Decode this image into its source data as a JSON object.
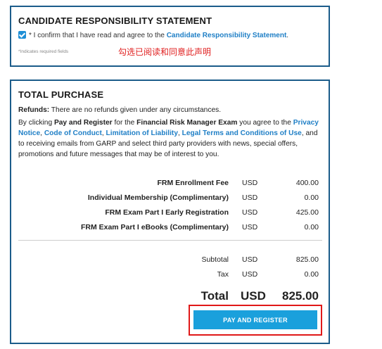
{
  "crs": {
    "title": "CANDIDATE RESPONSIBILITY STATEMENT",
    "confirm_text": "* I confirm that I have read and agree to the ",
    "confirm_link": "Candidate Responsibility Statement",
    "confirm_end": ".",
    "required_note": "*Indicates required fields",
    "annotation": "勾选已阅读和同意此声明"
  },
  "purchase": {
    "title": "TOTAL PURCHASE",
    "refunds_label": "Refunds:",
    "refunds_text": " There are no refunds given under any circumstances.",
    "agree_1": "By clicking ",
    "agree_bold_1": "Pay and Register",
    "agree_2": " for the ",
    "agree_bold_2": "Financial Risk Manager Exam",
    "agree_3": " you agree to the ",
    "link_privacy": "Privacy Notice",
    "link_conduct": "Code of Conduct",
    "link_liability": "Limitation of Liability",
    "link_terms": "Legal Terms and Conditions of Use",
    "agree_4": ", and to receiving emails from GARP and select third party providers with news, special offers, promotions and future messages that may be of interest to you.",
    "items": [
      {
        "label": "FRM Enrollment Fee",
        "currency": "USD",
        "amount": "400.00"
      },
      {
        "label": "Individual Membership (Complimentary)",
        "currency": "USD",
        "amount": "0.00"
      },
      {
        "label": "FRM Exam Part I Early Registration",
        "currency": "USD",
        "amount": "425.00"
      },
      {
        "label": "FRM Exam Part I eBooks (Complimentary)",
        "currency": "USD",
        "amount": "0.00"
      }
    ],
    "subtotal": {
      "label": "Subtotal",
      "currency": "USD",
      "amount": "825.00"
    },
    "tax": {
      "label": "Tax",
      "currency": "USD",
      "amount": "0.00"
    },
    "total": {
      "label": "Total",
      "currency": "USD",
      "amount": "825.00"
    },
    "button_label": "PAY AND REGISTER"
  }
}
